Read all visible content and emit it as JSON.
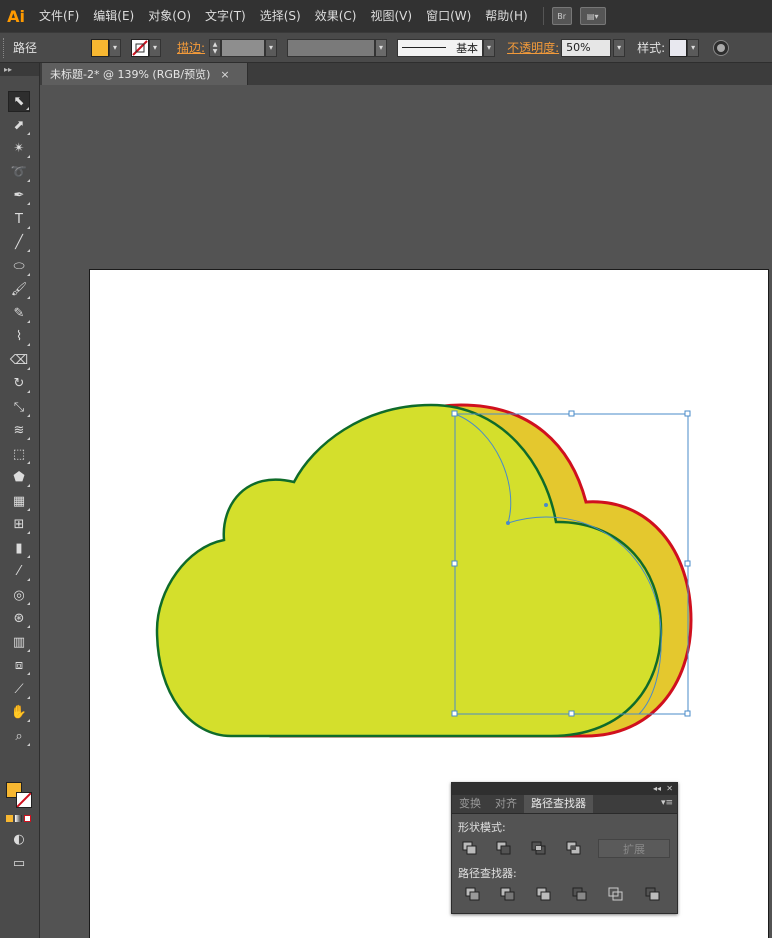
{
  "app": {
    "logo": "Ai"
  },
  "menu": [
    {
      "name": "menu-file",
      "label": "文件(F)"
    },
    {
      "name": "menu-edit",
      "label": "编辑(E)"
    },
    {
      "name": "menu-object",
      "label": "对象(O)"
    },
    {
      "name": "menu-type",
      "label": "文字(T)"
    },
    {
      "name": "menu-select",
      "label": "选择(S)"
    },
    {
      "name": "menu-effect",
      "label": "效果(C)"
    },
    {
      "name": "menu-view",
      "label": "视图(V)"
    },
    {
      "name": "menu-window",
      "label": "窗口(W)"
    },
    {
      "name": "menu-help",
      "label": "帮助(H)"
    }
  ],
  "menu_extra": {
    "bridge": "Br"
  },
  "control": {
    "selection_label": "路径",
    "stroke_label": "描边:",
    "stroke_style": "基本",
    "opacity_label": "不透明度:",
    "opacity_value": "50%",
    "style_label": "样式:",
    "fill_color": "#f7b731",
    "stroke_color": "#ffffff"
  },
  "document": {
    "tab_title": "未标题-2* @ 139% (RGB/预览)",
    "close": "×"
  },
  "artwork": {
    "cloud_fill": "#d4df2c",
    "cloud_back_fill": "#e4c82e",
    "stroke_red": "#d0101e",
    "stroke_green": "#0f6b2a",
    "selection_color": "#4a8bc8"
  },
  "pathfinder": {
    "tabs": [
      "变换",
      "对齐",
      "路径查找器"
    ],
    "active_tab": 2,
    "shape_modes_label": "形状模式:",
    "pathfinders_label": "路径查找器:",
    "expand_label": "扩展",
    "collapse": "◂◂",
    "close": "✕",
    "menu": "▾≡"
  }
}
